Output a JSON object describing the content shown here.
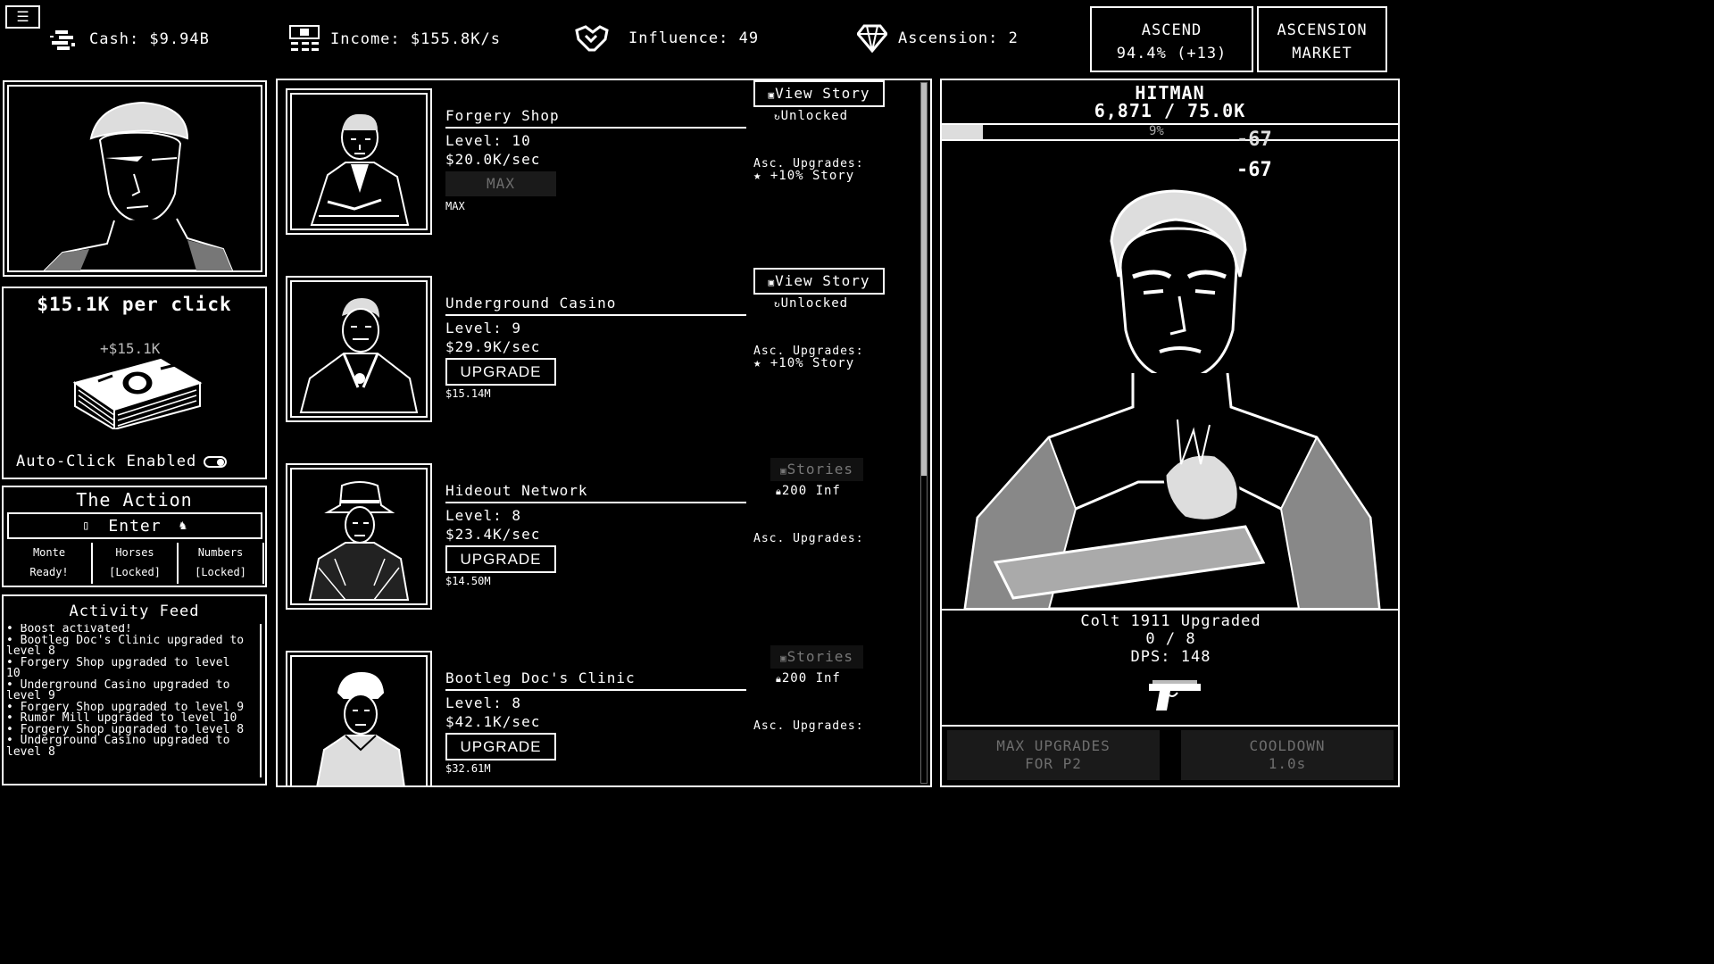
{
  "hud": {
    "menu_icon": "hamburger-icon",
    "cash_label": "Cash: $9.94B",
    "income_label": "Income: $155.8K/s",
    "influence_label": "Influence: 49",
    "ascension_label": "Ascension: 2",
    "ascend_title": "ASCEND",
    "ascend_sub": "94.4% (+13)",
    "market_line1": "ASCENSION",
    "market_line2": "MARKET"
  },
  "click_panel": {
    "per_click": "$15.1K per click",
    "float_text": "+$15.1K",
    "auto_click": "Auto-Click Enabled"
  },
  "action": {
    "title": "The Action",
    "enter": "Enter",
    "games": [
      {
        "name": "Monte",
        "status": "Ready!"
      },
      {
        "name": "Horses",
        "status": "[Locked]"
      },
      {
        "name": "Numbers",
        "status": "[Locked]"
      }
    ]
  },
  "feed": {
    "title": "Activity Feed",
    "items": [
      "• Boost activated!",
      "• Bootleg Doc's Clinic upgraded to level 8",
      "• Forgery Shop upgraded to level 10",
      "• Underground Casino upgraded to level 9",
      "• Forgery Shop upgraded to level 9",
      "• Rumor Mill upgraded to level 10",
      "• Forgery Shop upgraded to level 8",
      "• Underground Casino upgraded to level 8"
    ]
  },
  "businesses": [
    {
      "name": "Forgery Shop",
      "level": "Level: 10",
      "rate": "$20.0K/sec",
      "button": "MAX",
      "cost": "MAX",
      "story": "View Story",
      "story_status": "Unlocked",
      "asc_label": "Asc. Upgrades:",
      "asc_value": "★ +10% Story"
    },
    {
      "name": "Underground Casino",
      "level": "Level: 9",
      "rate": "$29.9K/sec",
      "button": "UPGRADE",
      "cost": "$15.14M",
      "story": "View Story",
      "story_status": "Unlocked",
      "asc_label": "Asc. Upgrades:",
      "asc_value": "★ +10% Story"
    },
    {
      "name": "Hideout Network",
      "level": "Level: 8",
      "rate": "$23.4K/sec",
      "button": "UPGRADE",
      "cost": "$14.50M",
      "story": "Stories",
      "story_status": "200 Inf",
      "asc_label": "Asc. Upgrades:",
      "asc_value": ""
    },
    {
      "name": "Bootleg Doc's Clinic",
      "level": "Level: 8",
      "rate": "$42.1K/sec",
      "button": "UPGRADE",
      "cost": "$32.61M",
      "story": "Stories",
      "story_status": "200 Inf",
      "asc_label": "Asc. Upgrades:",
      "asc_value": ""
    }
  ],
  "enemy": {
    "name": "HITMAN",
    "hp": "6,871 / 75.0K",
    "hp_percent": 9,
    "hp_percent_label": "9%",
    "damage_1": "-67",
    "damage_2": "-67",
    "weapon": "Colt 1911 Upgraded",
    "weapon_progress": "0 / 8",
    "dps": "DPS: 148",
    "max_upgrades_1": "MAX UPGRADES",
    "max_upgrades_2": "FOR P2",
    "cooldown_1": "COOLDOWN",
    "cooldown_2": "1.0s"
  }
}
